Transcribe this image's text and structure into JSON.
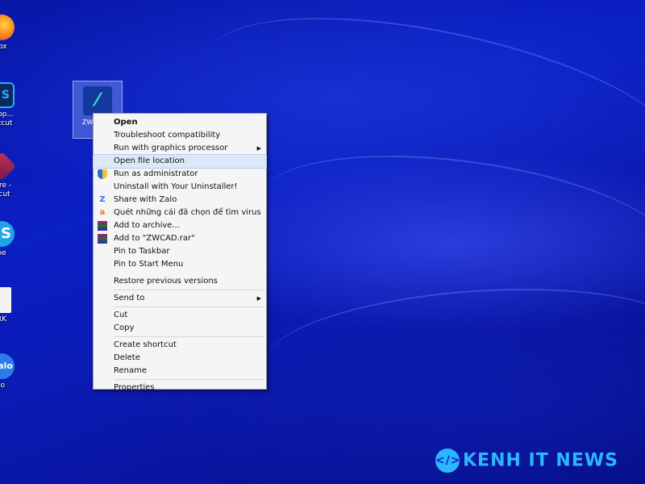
{
  "desktop": {
    "icons": [
      {
        "label": "lox",
        "icon": "firefox-icon",
        "color": "#f57c16"
      },
      {
        "label": "shop...\nortcut",
        "icon": "photoshop-icon",
        "color": "#1b5fa8"
      },
      {
        "label": "ture -\nrtcut",
        "icon": "app-icon",
        "color": "#c0305a"
      },
      {
        "label": "pe",
        "icon": "skype-icon",
        "color": "#1fa4e8"
      },
      {
        "label": "RK",
        "icon": "document-icon",
        "color": "#e8e8e8"
      },
      {
        "label": "lo",
        "icon": "zalo-icon",
        "color": "#2b7bea"
      }
    ],
    "selected_icon": {
      "label": "ZWCAD...",
      "icon": "zwcad-icon"
    }
  },
  "context_menu": {
    "items": [
      {
        "label": "Open",
        "bold": true
      },
      {
        "label": "Troubleshoot compatibility"
      },
      {
        "label": "Run with graphics processor",
        "submenu": true
      },
      {
        "label": "Open file location",
        "highlighted": true
      },
      {
        "label": "Run as administrator",
        "icon": "shield-icon"
      },
      {
        "label": "Uninstall with Your Uninstaller!"
      },
      {
        "label": "Share with Zalo",
        "icon": "zalo-icon"
      },
      {
        "label": "Quét những cái đã chọn để tìm virus",
        "icon": "avast-icon"
      },
      {
        "label": "Add to archive...",
        "icon": "winrar-icon"
      },
      {
        "label": "Add to \"ZWCAD.rar\"",
        "icon": "winrar-icon"
      },
      {
        "label": "Pin to Taskbar"
      },
      {
        "label": "Pin to Start Menu"
      },
      {
        "label": "Restore previous versions"
      },
      {
        "label": "Send to",
        "submenu": true
      },
      {
        "label": "Cut"
      },
      {
        "label": "Copy"
      },
      {
        "label": "Create shortcut"
      },
      {
        "label": "Delete"
      },
      {
        "label": "Rename"
      },
      {
        "label": "Properties"
      }
    ]
  },
  "watermark": {
    "text": "KENH IT NEWS",
    "icon": "code-icon",
    "color": "#2ab7ff"
  }
}
